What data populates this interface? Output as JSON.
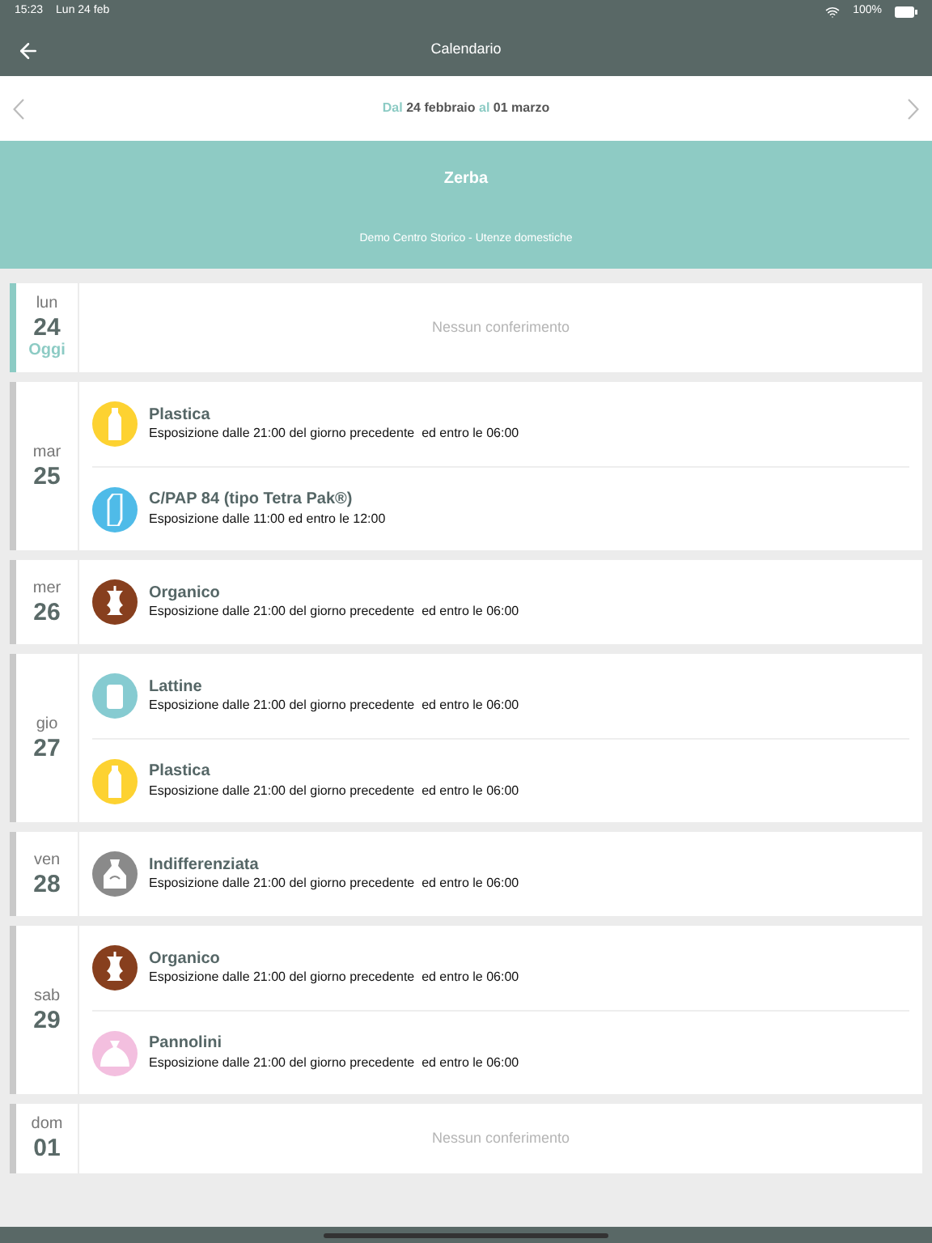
{
  "status_bar": {
    "time": "15:23",
    "date": "Lun 24 feb",
    "battery": "100%"
  },
  "header": {
    "title": "Calendario"
  },
  "range": {
    "from_label": "Dal",
    "from": "24 febbraio",
    "to_label": "al",
    "to": "01 marzo"
  },
  "banner": {
    "title": "Zerba",
    "subtitle": "Demo Centro Storico - Utenze domestiche"
  },
  "days": [
    {
      "weekday": "lun",
      "day": "24",
      "today": true,
      "today_label": "Oggi",
      "empty": "Nessun conferimento"
    },
    {
      "weekday": "mar",
      "day": "25",
      "today": false,
      "entries": [
        {
          "kind": "bottle",
          "color": "#fdd231",
          "name": "Plastica",
          "detail": "Esposizione dalle 21:00 del giorno precedente  ed entro le 06:00"
        },
        {
          "kind": "carton",
          "color": "#4fbbe8",
          "name": "C/PAP 84 (tipo Tetra Pak®)",
          "detail": "Esposizione dalle 11:00 ed entro le 12:00"
        }
      ]
    },
    {
      "weekday": "mer",
      "day": "26",
      "today": false,
      "entries": [
        {
          "kind": "apple",
          "color": "#873f1e",
          "name": "Organico",
          "detail": "Esposizione dalle 21:00 del giorno precedente  ed entro le 06:00"
        }
      ]
    },
    {
      "weekday": "gio",
      "day": "27",
      "today": false,
      "entries": [
        {
          "kind": "can",
          "color": "#86cbd1",
          "name": "Lattine",
          "detail": "Esposizione dalle 21:00 del giorno precedente  ed entro le 06:00"
        },
        {
          "kind": "bottle",
          "color": "#fdd231",
          "name": "Plastica",
          "detail": "Esposizione dalle 21:00 del giorno precedente  ed entro le 06:00"
        }
      ]
    },
    {
      "weekday": "ven",
      "day": "28",
      "today": false,
      "entries": [
        {
          "kind": "bag",
          "color": "#8a8a8a",
          "name": "Indifferenziata",
          "detail": "Esposizione dalle 21:00 del giorno precedente  ed entro le 06:00"
        }
      ]
    },
    {
      "weekday": "sab",
      "day": "29",
      "today": false,
      "entries": [
        {
          "kind": "apple",
          "color": "#873f1e",
          "name": "Organico",
          "detail": "Esposizione dalle 21:00 del giorno precedente  ed entro le 06:00"
        },
        {
          "kind": "sack",
          "color": "#f3bfdf",
          "name": "Pannolini",
          "detail": "Esposizione dalle 21:00 del giorno precedente  ed entro le 06:00"
        }
      ]
    },
    {
      "weekday": "dom",
      "day": "01",
      "today": false,
      "empty": "Nessun conferimento"
    }
  ]
}
